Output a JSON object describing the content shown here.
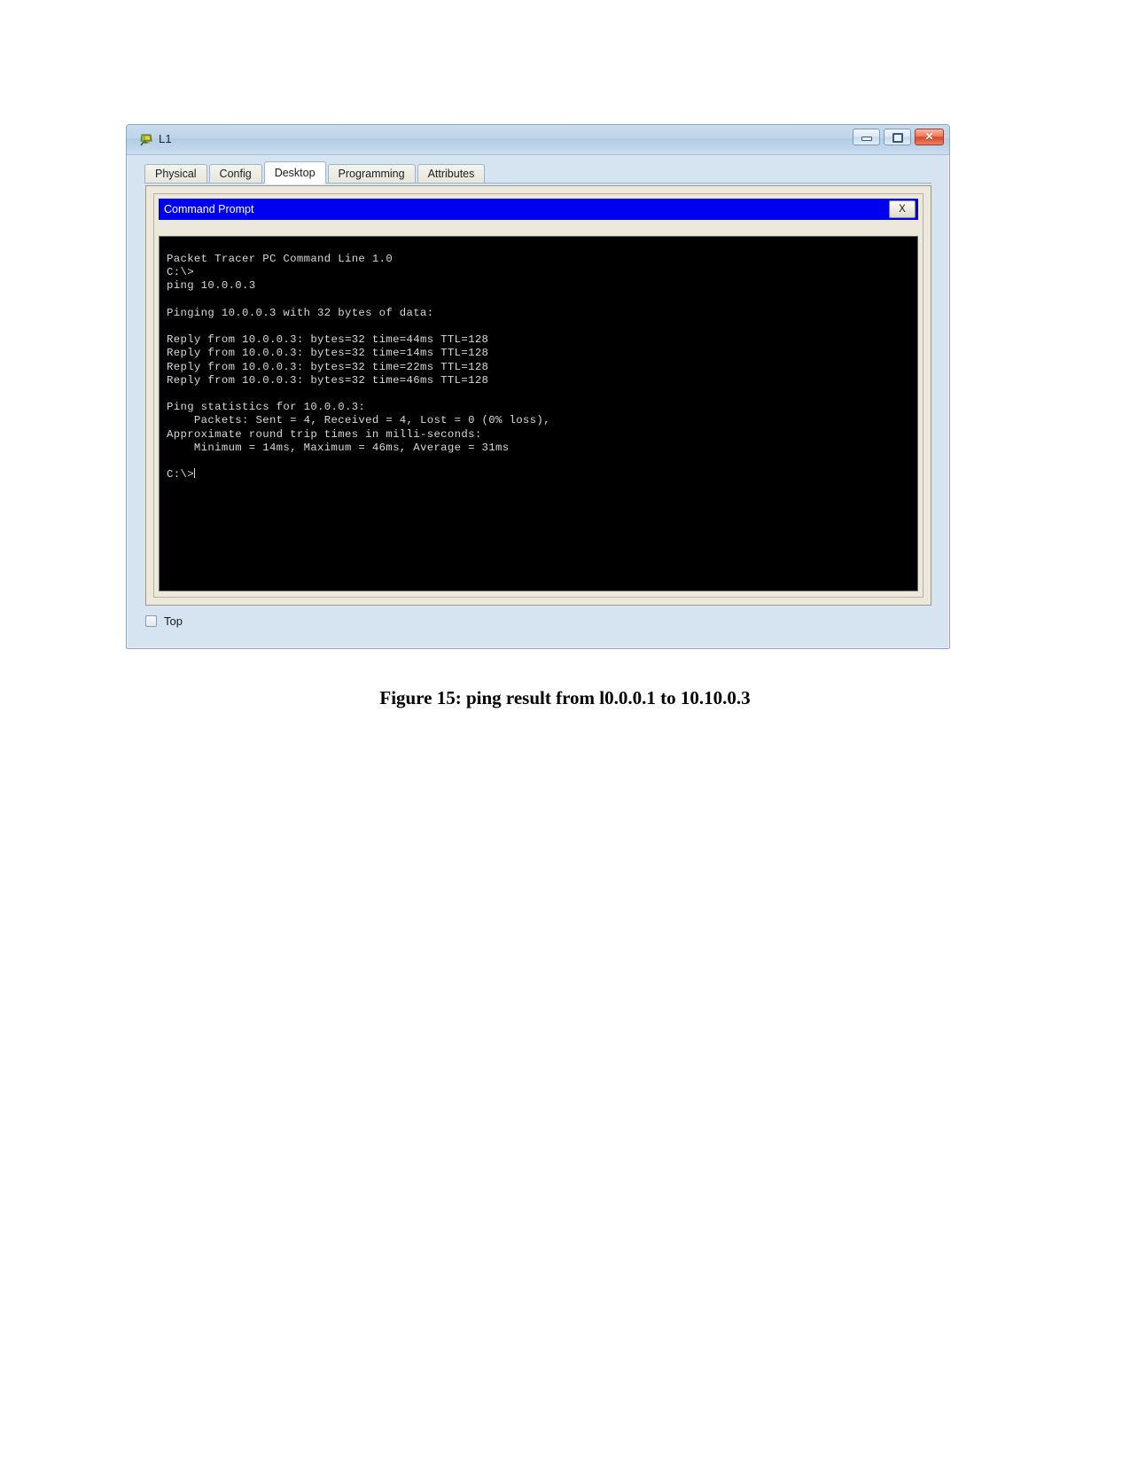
{
  "window": {
    "title": "L1",
    "icon": "packet-tracer-device-icon",
    "controls": {
      "minimize_label": "",
      "maximize_label": "",
      "close_label": "✕"
    }
  },
  "tabs": [
    {
      "label": "Physical",
      "active": false
    },
    {
      "label": "Config",
      "active": false
    },
    {
      "label": "Desktop",
      "active": true
    },
    {
      "label": "Programming",
      "active": false
    },
    {
      "label": "Attributes",
      "active": false
    }
  ],
  "command_prompt": {
    "title": "Command Prompt",
    "close_label": "X",
    "header_color": "#0000f0",
    "terminal_bg": "#000000",
    "terminal_fg": "#d8d8d8",
    "lines": [
      "Packet Tracer PC Command Line 1.0",
      "C:\\>",
      "ping 10.0.0.3",
      "",
      "Pinging 10.0.0.3 with 32 bytes of data:",
      "",
      "Reply from 10.0.0.3: bytes=32 time=44ms TTL=128",
      "Reply from 10.0.0.3: bytes=32 time=14ms TTL=128",
      "Reply from 10.0.0.3: bytes=32 time=22ms TTL=128",
      "Reply from 10.0.0.3: bytes=32 time=46ms TTL=128",
      "",
      "Ping statistics for 10.0.0.3:",
      "    Packets: Sent = 4, Received = 4, Lost = 0 (0% loss),",
      "Approximate round trip times in milli-seconds:",
      "    Minimum = 14ms, Maximum = 46ms, Average = 31ms",
      "",
      "C:\\>"
    ],
    "ping_summary": {
      "target": "10.0.0.3",
      "bytes": 32,
      "ttl": 128,
      "times_ms": [
        44,
        14,
        22,
        46
      ],
      "sent": 4,
      "received": 4,
      "lost": 0,
      "loss_percent": 0,
      "minimum_ms": 14,
      "maximum_ms": 46,
      "average_ms": 31
    }
  },
  "bottom": {
    "top_checkbox_label": "Top",
    "top_checkbox_checked": false
  },
  "caption": {
    "text": "Figure 15: ping result from l0.0.0.1 to 10.10.0.3"
  }
}
